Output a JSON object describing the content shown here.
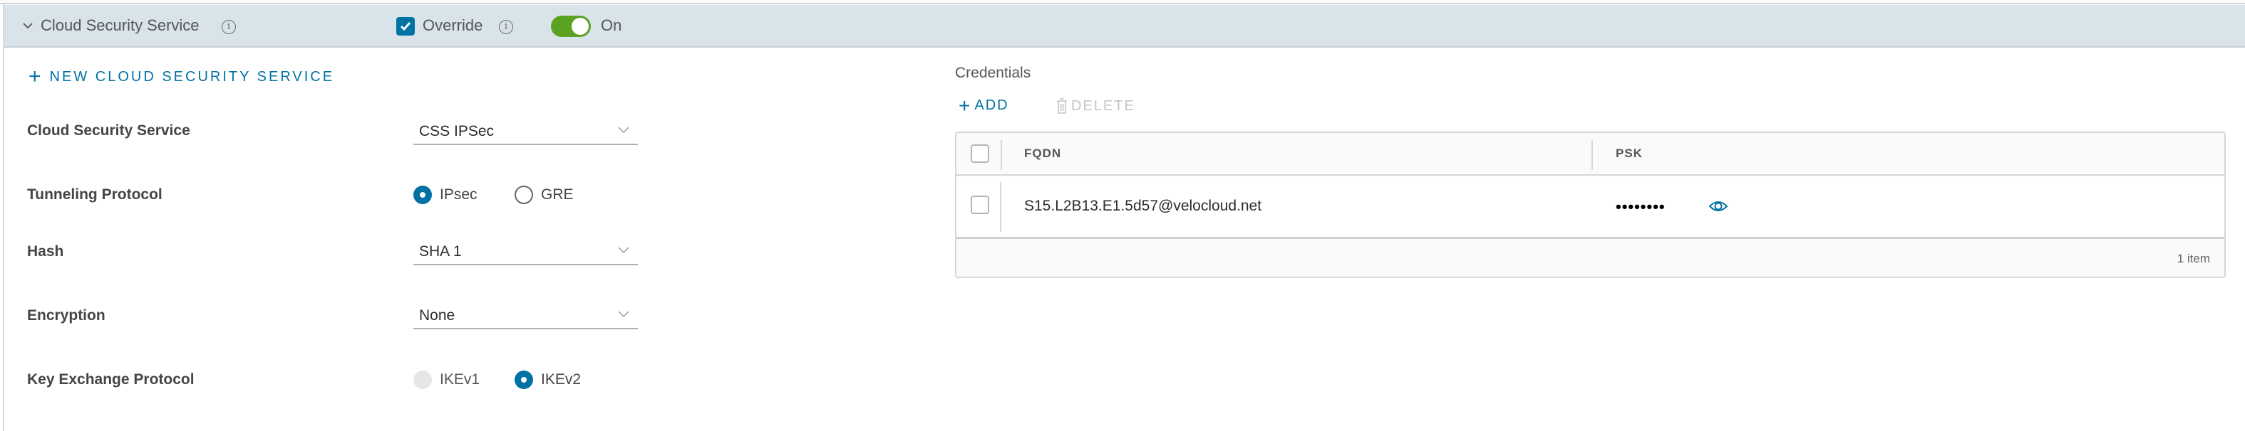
{
  "header": {
    "title": "Cloud Security Service",
    "override_label": "Override",
    "override_checked": true,
    "toggle_on": true,
    "toggle_label": "On"
  },
  "new_service_button": "NEW CLOUD SECURITY SERVICE",
  "form": {
    "cloud_security_service": {
      "label": "Cloud Security Service",
      "value": "CSS IPSec"
    },
    "tunneling_protocol": {
      "label": "Tunneling Protocol",
      "options": [
        {
          "label": "IPsec",
          "selected": true
        },
        {
          "label": "GRE",
          "selected": false
        }
      ]
    },
    "hash": {
      "label": "Hash",
      "value": "SHA 1"
    },
    "encryption": {
      "label": "Encryption",
      "value": "None"
    },
    "key_exchange_protocol": {
      "label": "Key Exchange Protocol",
      "options": [
        {
          "label": "IKEv1",
          "selected": false,
          "disabled": true
        },
        {
          "label": "IKEv2",
          "selected": true
        }
      ]
    }
  },
  "credentials": {
    "title": "Credentials",
    "add_label": "ADD",
    "delete_label": "DELETE",
    "columns": [
      "FQDN",
      "PSK"
    ],
    "rows": [
      {
        "fqdn": "S15.L2B13.E1.5d57@velocloud.net",
        "psk": "••••••••"
      }
    ],
    "footer_count": "1 item"
  },
  "colors": {
    "accent": "#0072a3",
    "toggle_on": "#5aa220",
    "header_bg": "#d9e3ea"
  }
}
